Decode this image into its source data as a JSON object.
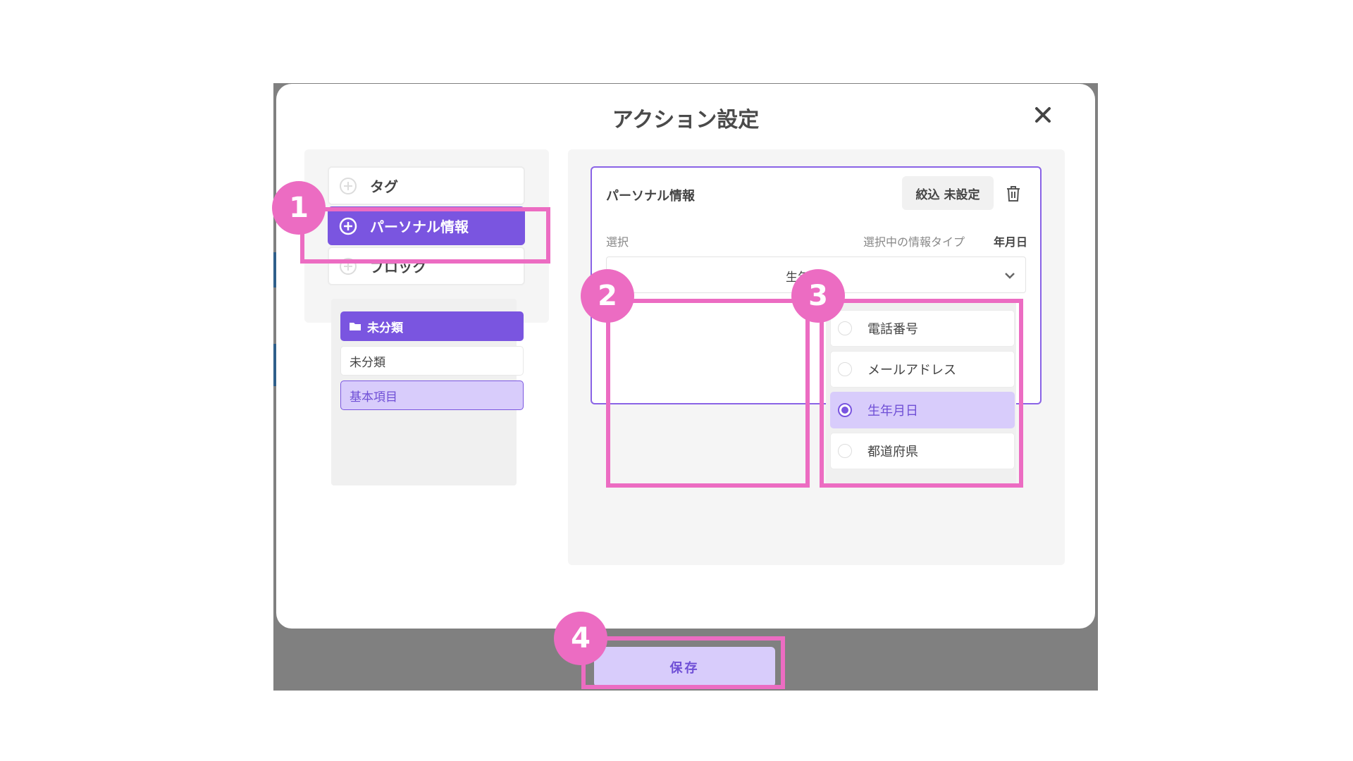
{
  "modal": {
    "title": "アクション設定",
    "close_icon": "close-icon"
  },
  "actions": {
    "items": [
      {
        "label": "タグ",
        "icon": "plus-circle-icon",
        "active": false
      },
      {
        "label": "パーソナル情報",
        "icon": "plus-circle-icon",
        "active": true
      },
      {
        "label": "ブロック",
        "icon": "plus-circle-icon",
        "active": false
      }
    ]
  },
  "card": {
    "title": "パーソナル情報",
    "filter_button": "絞込 未設定",
    "trash_icon": "trash-icon",
    "select_label": "選択",
    "type_label": "選択中の情報タイプ",
    "type_value": "年月日",
    "select_value": "生年",
    "chevron_icon": "chevron-down-icon"
  },
  "dropdown": {
    "categories": [
      {
        "label": "未分類",
        "style": "header",
        "icon": "folder-icon"
      },
      {
        "label": "未分類",
        "style": "plain"
      },
      {
        "label": "基本項目",
        "style": "selected"
      }
    ],
    "options": [
      {
        "label": "電話番号",
        "selected": false
      },
      {
        "label": "メールアドレス",
        "selected": false
      },
      {
        "label": "生年月日",
        "selected": true
      },
      {
        "label": "都道府県",
        "selected": false
      }
    ]
  },
  "footer": {
    "save_label": "保存"
  },
  "badges": [
    "1",
    "2",
    "3",
    "4"
  ],
  "colors": {
    "accent": "#7a55e0",
    "accent_light": "#d8ccfb",
    "highlight": "#ec6cc2",
    "backdrop": "#808080"
  }
}
